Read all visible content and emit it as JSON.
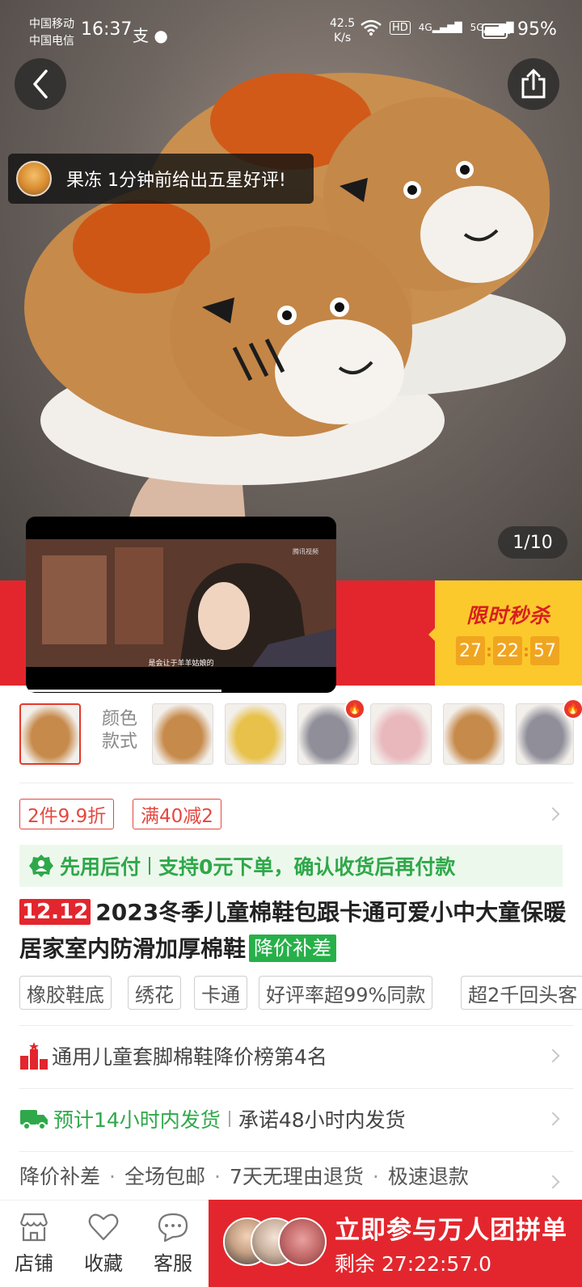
{
  "status_bar": {
    "carrier1": "中国移动",
    "carrier2": "中国电信",
    "time": "16:37",
    "app_icons": "支 ●",
    "net_speed_value": "42.5",
    "net_speed_unit": "K/s",
    "hd_label": "HD",
    "signal_4g": "4G",
    "signal_5g": "5G",
    "battery_percent": "95%",
    "battery_level": 0.95
  },
  "review_toast": {
    "text": "果冻 1分钟前给出五星好评!"
  },
  "gallery": {
    "counter": "1/10"
  },
  "flash_sale": {
    "title": "限时秒杀",
    "hours": "27",
    "minutes": "22",
    "seconds": "57",
    "separator": ":"
  },
  "mini_video": {
    "subtitle": "是会让于羊羊姑娘的",
    "watermark": "腾讯视频",
    "progress": 0.63
  },
  "sku": {
    "label": "颜色款式",
    "variants": [
      "棕色",
      "棕色",
      "黄色",
      "灰色",
      "粉色",
      "棕色",
      "灰色"
    ],
    "hot_marker": "🔥"
  },
  "promotions": {
    "tag1": "2件9.9折",
    "tag2": "满40减2"
  },
  "pay_later": {
    "title": "先用后付",
    "description": "支持0元下单，确认收货后再付款"
  },
  "product": {
    "badge": "12.12",
    "title": "2023冬季儿童棉鞋包跟卡通可爱小中大童保暖居家室内防滑加厚棉鞋",
    "price_badge": "降价补差"
  },
  "attributes": [
    "橡胶鞋底",
    "绣花",
    "卡通",
    "好评率超99%同款",
    "超2千回头客"
  ],
  "ranking": {
    "text": "通用儿童套脚棉鞋降价榜第4名"
  },
  "shipping": {
    "estimate": "预计14小时内发货",
    "promise": "承诺48小时内发货"
  },
  "services": [
    "降价补差",
    "全场包邮",
    "7天无理由退货",
    "极速退款"
  ],
  "service_separator": "·",
  "bottom_nav": {
    "shop": "店铺",
    "favorite": "收藏",
    "service": "客服"
  },
  "group_buy": {
    "title": "立即参与万人团拼单",
    "remaining": "剩余 27:22:57.0"
  },
  "colors": {
    "brand_red": "#e3262d",
    "flash_yellow": "#fbc92c",
    "green": "#2fa84a"
  }
}
